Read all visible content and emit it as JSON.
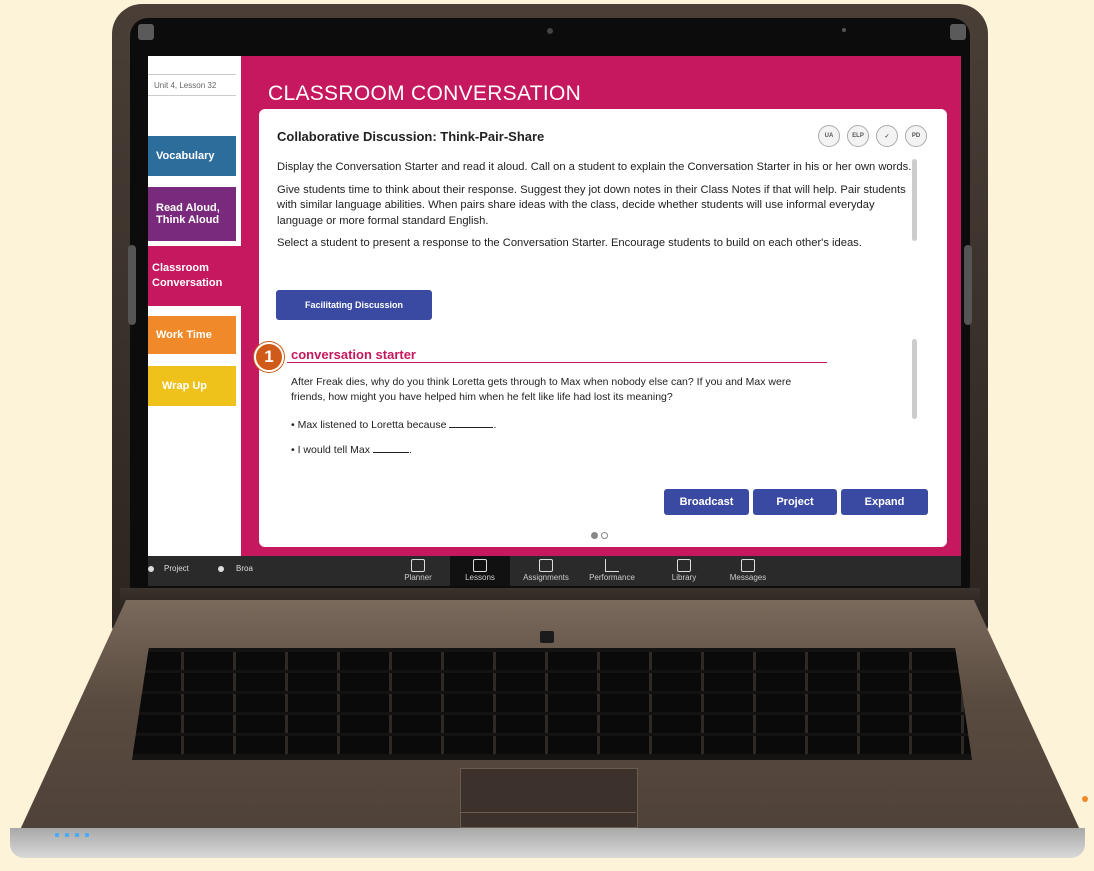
{
  "sidebar": {
    "breadcrumb": "Unit 4, Lesson 32",
    "items": [
      {
        "label": "Vocabulary"
      },
      {
        "label": "Read Aloud,\nThink Aloud"
      },
      {
        "label": "Classroom\nConversation"
      },
      {
        "label": "Work Time"
      },
      {
        "label": "Wrap Up"
      }
    ]
  },
  "page": {
    "title": "CLASSROOM CONVERSATION"
  },
  "card": {
    "heading": "Collaborative Discussion: Think-Pair-Share",
    "badges": [
      "UA",
      "ELP",
      "✓",
      "PD"
    ],
    "paragraphs": [
      "Display the Conversation Starter and read it aloud. Call on a student to explain the Conversation Starter in his or her own words.",
      "Give students time to think about their response. Suggest they jot down notes in their Class Notes if that will help. Pair students with similar language abilities. When pairs share ideas with the class, decide whether students will use informal everyday language or more formal standard English.",
      "Select a student to present a response to the Conversation Starter. Encourage students to build on each other's ideas."
    ],
    "facilitating_button": "Facilitating Discussion",
    "starter": {
      "number": "1",
      "title": "conversation starter",
      "body": "After Freak dies, why do you think Loretta gets through to Max when nobody else can? If you and Max were friends, how might you have helped him when he felt like life had lost its meaning?",
      "bullet1": "Max listened to Loretta because",
      "bullet2": "I would tell Max"
    },
    "actions": {
      "broadcast": "Broadcast",
      "project": "Project",
      "expand": "Expand"
    }
  },
  "bottombar": {
    "project": "Project",
    "broadcast": "Broa",
    "nav": [
      "Planner",
      "Lessons",
      "Assignments",
      "Performance",
      "Library",
      "Messages"
    ]
  },
  "colors": {
    "accent": "#c6185f",
    "button": "#3a4aa3",
    "vocabulary": "#2d6d9c",
    "read_aloud": "#7a2a7c",
    "work_time": "#f0892a",
    "wrap_up": "#eec11b"
  },
  "pagination": {
    "current": 1,
    "total": 2
  }
}
